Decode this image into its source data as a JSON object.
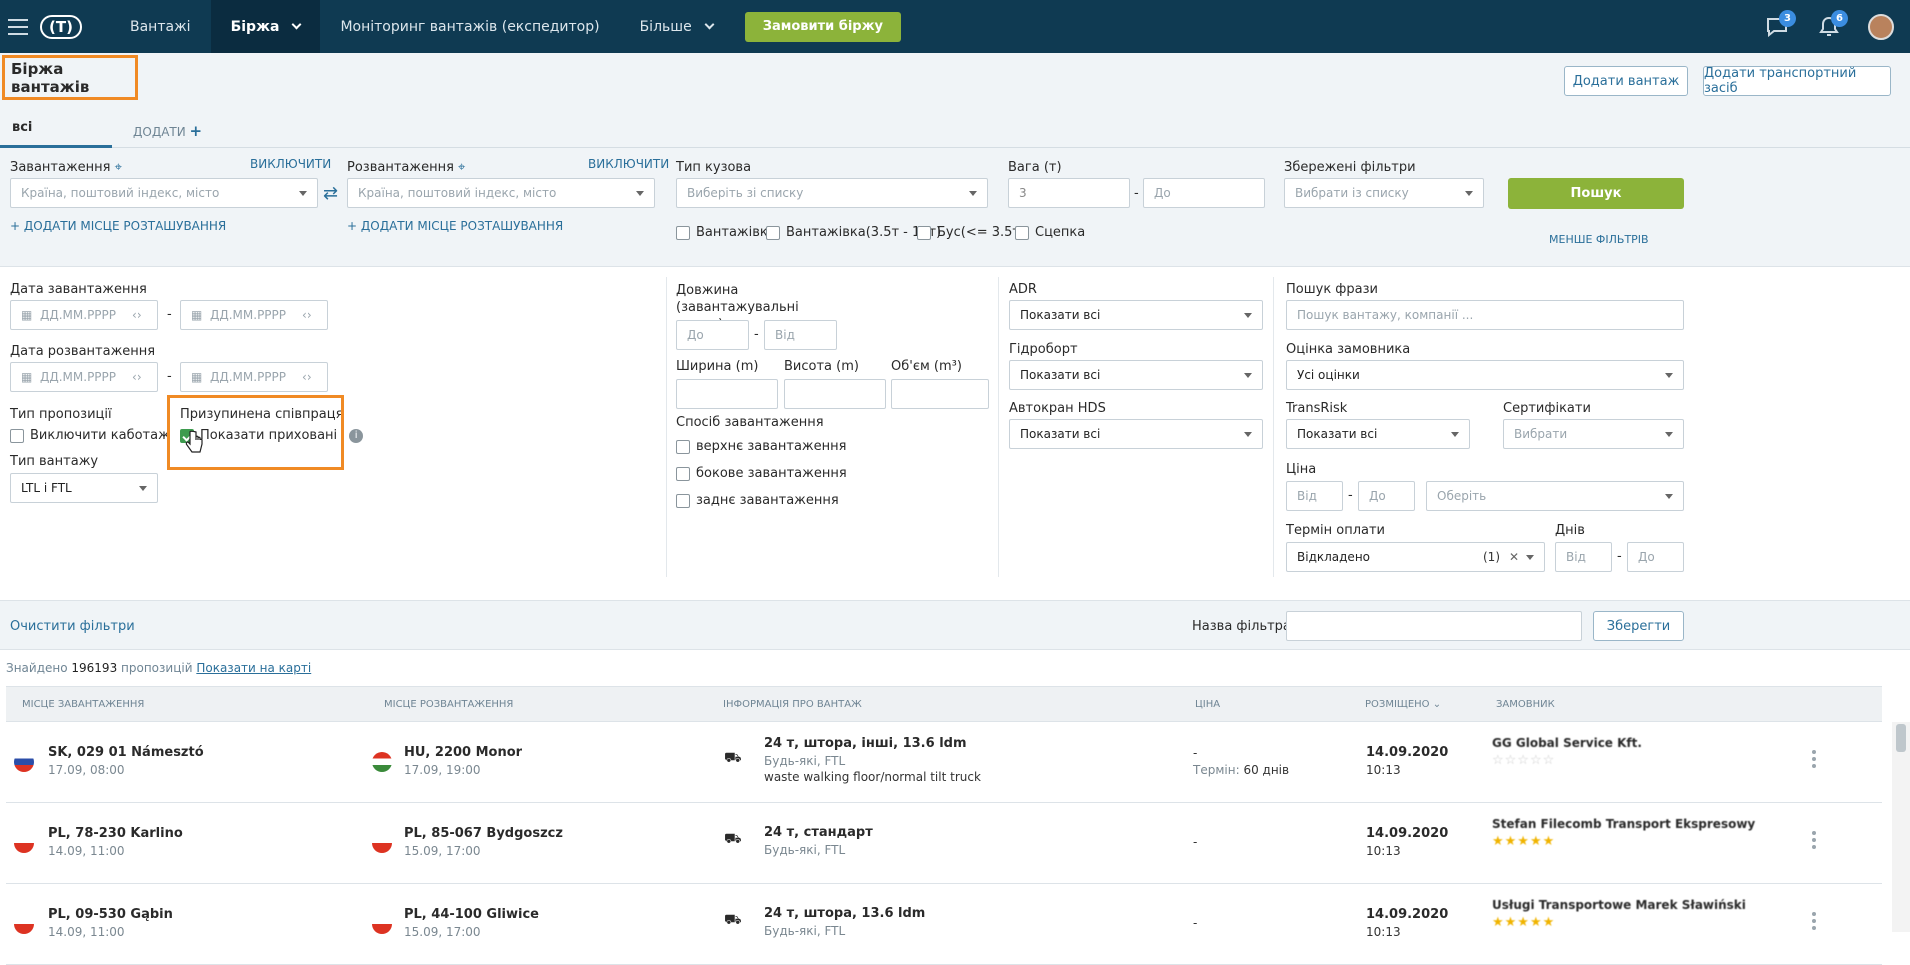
{
  "nav": {
    "items": [
      "Вантажі",
      "Біржа",
      "Моніторинг вантажів (експедитор)",
      "Більше"
    ],
    "order_button": "Замовити біржу",
    "messages_badge": "3",
    "notifications_badge": "6"
  },
  "page": {
    "title": "Біржа вантажів",
    "add_cargo": "Додати вантаж",
    "add_vehicle": "Додати транспортний засіб",
    "tab_all": "всі",
    "tab_add": "ДОДАТИ"
  },
  "filters": {
    "loading_label": "Завантаження",
    "loading_exclude": "ВИКЛЮЧИТИ",
    "loading_placeholder": "Країна, поштовий індекс, місто",
    "add_location": "ДОДАТИ МІСЦЕ РОЗТАШУВАННЯ",
    "unloading_label": "Розвантаження",
    "unloading_exclude": "ВИКЛЮЧИТИ",
    "unloading_placeholder": "Країна, поштовий індекс, місто",
    "add_location2": "ДОДАТИ МІСЦЕ РОЗТАШУВАННЯ",
    "body_label": "Тип кузова",
    "body_placeholder": "Виберіть зі списку",
    "body_options": [
      "Вантажівка",
      "Вантажівка(3.5т - 12т)",
      "Бус(<= 3.5т)",
      "Сцепка"
    ],
    "weight_label": "Вага (т)",
    "weight_from": "3",
    "weight_to": "До",
    "saved_label": "Збережені фільтри",
    "saved_placeholder": "Вибрати із списку",
    "search_button": "Пошук",
    "less_filters": "МЕНШЕ ФІЛЬТРІВ",
    "load_date": "Дата завантаження",
    "unload_date": "Дата розвантаження",
    "date_placeholder": "ДД.ММ.РРРР",
    "offer_type": "Тип пропозиції",
    "exclude_cabotage": "Виключити каботаж",
    "paused": "Призупинена співпраця",
    "show_hidden": "Показати приховані",
    "cargo_type": "Тип вантажу",
    "cargo_type_value": "LTL і FTL",
    "length_label": "Довжина (завантажувальні метри)",
    "len_to": "До",
    "len_from": "Від",
    "width_label": "Ширина (m)",
    "height_label": "Висота (m)",
    "volume_label": "Об'єм (m³)",
    "loading_method": "Спосіб завантаження",
    "methods": [
      "верхнє завантаження",
      "бокове завантаження",
      "заднє завантаження"
    ],
    "adr": "ADR",
    "adr_value": "Показати всі",
    "tail_lift": "Гідроборт",
    "tail_lift_value": "Показати всі",
    "crane": "Автокран HDS",
    "crane_value": "Показати всі",
    "phrase": "Пошук фрази",
    "phrase_placeholder": "Пошук вантажу, компанії ...",
    "rating": "Оцінка замовника",
    "rating_value": "Усі оцінки",
    "transrisk": "TransRisk",
    "transrisk_value": "Показати всі",
    "certs": "Сертифікати",
    "certs_value": "Вибрати",
    "price": "Ціна",
    "price_from": "Від",
    "price_to": "До",
    "currency": "Оберіть",
    "payment": "Термін оплати",
    "payment_value": "Відкладено",
    "payment_count": "(1)",
    "days": "Днів",
    "days_from": "Від",
    "days_to": "До",
    "clear": "Очистити фільтри",
    "filter_name": "Назва фільтра:",
    "save": "Зберегти"
  },
  "results": {
    "found_prefix": "Знайдено",
    "count": "196193",
    "found_suffix": "пропозицій",
    "map_link": "Показати на карті"
  },
  "table": {
    "headers": [
      "МІСЦЕ ЗАВАНТАЖЕННЯ",
      "МІСЦЕ РОЗВАНТАЖЕННЯ",
      "ІНФОРМАЦІЯ ПРО ВАНТАЖ",
      "ЦІНА",
      "РОЗМІЩЕНО",
      "ЗАМОВНИК"
    ],
    "rows": [
      {
        "from": "SK, 029 01 Námesztó",
        "from_date": "17.09, 08:00",
        "to": "HU, 2200 Monor",
        "to_date": "17.09, 19:00",
        "info": "24 т, штора, інші, 13.6 ldm",
        "info2": "Будь-які, FTL",
        "info3": "waste walking floor/normal tilt truck",
        "price": "-",
        "term_label": "Термін:",
        "term": "60 днів",
        "date": "14.09.2020",
        "time": "10:13",
        "customer": "GG Global Service Kft."
      },
      {
        "from": "PL, 78-230 Karlino",
        "from_date": "14.09, 11:00",
        "to": "PL, 85-067 Bydgoszcz",
        "to_date": "15.09, 17:00",
        "info": "24 т, стандарт",
        "info2": "Будь-які, FTL",
        "info3": "",
        "price": "-",
        "term_label": "",
        "term": "",
        "date": "14.09.2020",
        "time": "10:13",
        "customer": "Stefan Filecomb Transport Ekspresowy"
      },
      {
        "from": "PL, 09-530 Gąbin",
        "from_date": "14.09, 11:00",
        "to": "PL, 44-100 Gliwice",
        "to_date": "15.09, 17:00",
        "info": "24 т, штора, 13.6 ldm",
        "info2": "Будь-які, FTL",
        "info3": "",
        "price": "-",
        "term_label": "",
        "term": "",
        "date": "14.09.2020",
        "time": "10:13",
        "customer": "Usługi Transportowe Marek Sławiński"
      }
    ]
  }
}
